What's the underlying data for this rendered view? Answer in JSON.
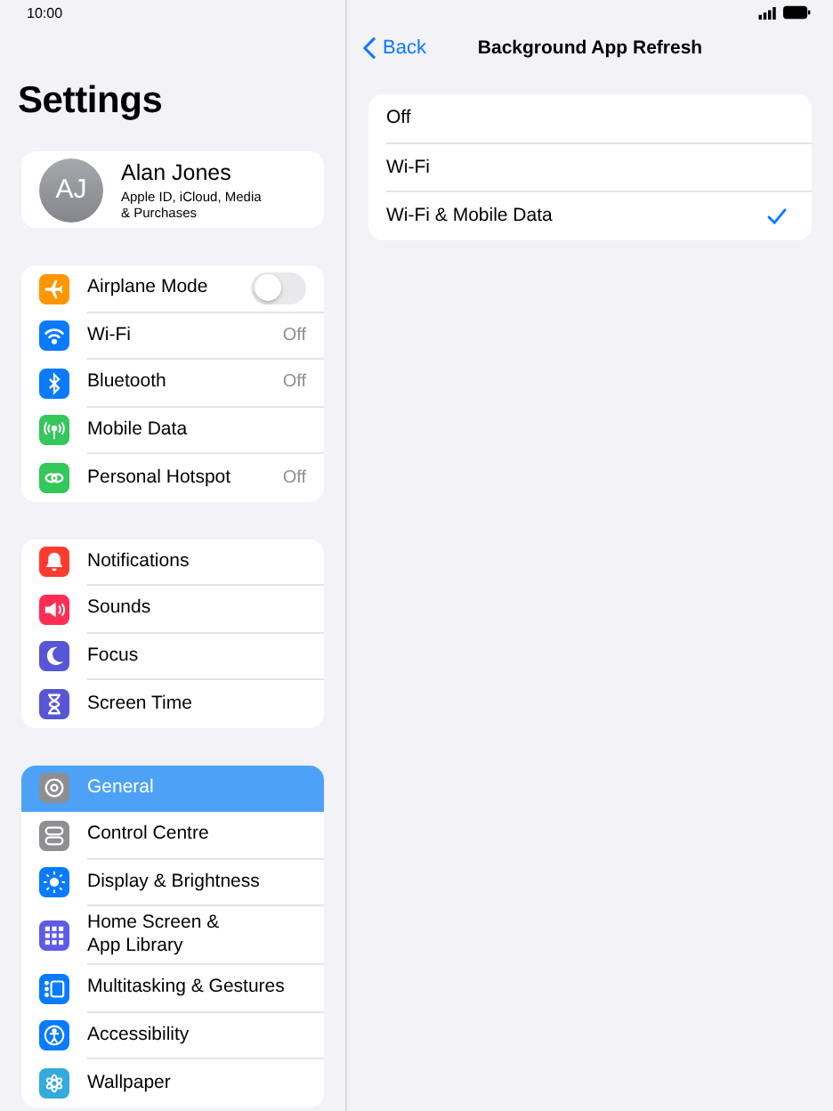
{
  "status_bar": {
    "time": "10:00"
  },
  "sidebar": {
    "title": "Settings",
    "profile": {
      "initials": "AJ",
      "name": "Alan Jones",
      "subtitle": "Apple ID, iCloud, Media\n& Purchases"
    },
    "groups": [
      {
        "items": [
          {
            "label": "Airplane Mode",
            "color": "#ff9500",
            "selected": false,
            "kind": "toggle",
            "on": false
          },
          {
            "label": "Wi-Fi",
            "color": "#0a7aff",
            "selected": false,
            "kind": "value",
            "value": "Off"
          },
          {
            "label": "Bluetooth",
            "color": "#0a7aff",
            "selected": false,
            "kind": "value",
            "value": "Off"
          },
          {
            "label": "Mobile Data",
            "color": "#34c759",
            "selected": false,
            "kind": "plain"
          },
          {
            "label": "Personal Hotspot",
            "color": "#34c759",
            "selected": false,
            "kind": "value",
            "value": "Off"
          }
        ]
      },
      {
        "items": [
          {
            "label": "Notifications",
            "color": "#ff3b30",
            "selected": false,
            "kind": "plain"
          },
          {
            "label": "Sounds",
            "color": "#ff2d55",
            "selected": false,
            "kind": "plain"
          },
          {
            "label": "Focus",
            "color": "#5856d6",
            "selected": false,
            "kind": "plain"
          },
          {
            "label": "Screen Time",
            "color": "#5856d6",
            "selected": false,
            "kind": "plain"
          }
        ]
      },
      {
        "items": [
          {
            "label": "General",
            "color": "#8e8e93",
            "selected": true,
            "kind": "plain"
          },
          {
            "label": "Control Centre",
            "color": "#8e8e93",
            "selected": false,
            "kind": "plain"
          },
          {
            "label": "Display & Brightness",
            "color": "#0a7aff",
            "selected": false,
            "kind": "plain"
          },
          {
            "label": "Home Screen &\nApp Library",
            "color": "#5e5ce6",
            "selected": false,
            "kind": "plain"
          },
          {
            "label": "Multitasking & Gestures",
            "color": "#0a7aff",
            "selected": false,
            "kind": "plain"
          },
          {
            "label": "Accessibility",
            "color": "#0a7aff",
            "selected": false,
            "kind": "plain"
          },
          {
            "label": "Wallpaper",
            "color": "#35aadc",
            "selected": false,
            "kind": "plain"
          }
        ]
      }
    ]
  },
  "detail": {
    "back": "Back",
    "title": "Background App Refresh",
    "options": [
      {
        "label": "Off",
        "selected": false
      },
      {
        "label": "Wi-Fi",
        "selected": false
      },
      {
        "label": "Wi-Fi & Mobile Data",
        "selected": true
      }
    ]
  }
}
